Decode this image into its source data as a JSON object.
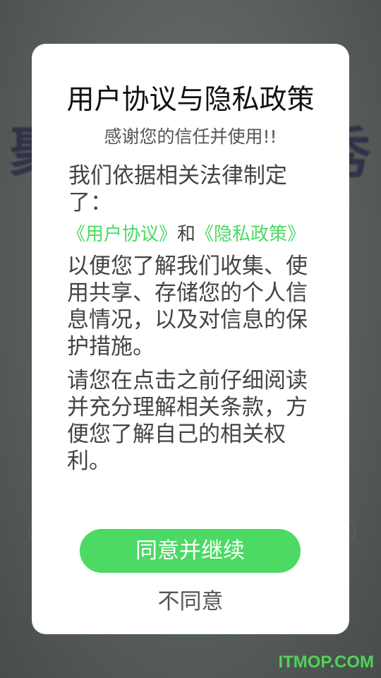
{
  "background": {
    "text_left": "聚",
    "text_right": "秀"
  },
  "dialog": {
    "title": "用户协议与隐私政策",
    "subtitle": "感谢您的信任并使用!!",
    "intro": "我们依据相关法律制定了：",
    "links": {
      "user_agreement": "《用户协议》",
      "and": "和",
      "privacy_policy": "《隐私政策》"
    },
    "paragraph1": "以便您了解我们收集、使用共享、存储您的个人信息情况，以及对信息的保护措施。",
    "paragraph2": "请您在点击之前仔细阅读并充分理解相关条款，方便您了解自己的相关权利。",
    "agree_label": "同意并继续",
    "disagree_label": "不同意"
  },
  "watermark": "ITMOP.COM",
  "colors": {
    "accent": "#4cd964",
    "dialog_bg": "#ffffff",
    "overlay": "#5c6360"
  }
}
